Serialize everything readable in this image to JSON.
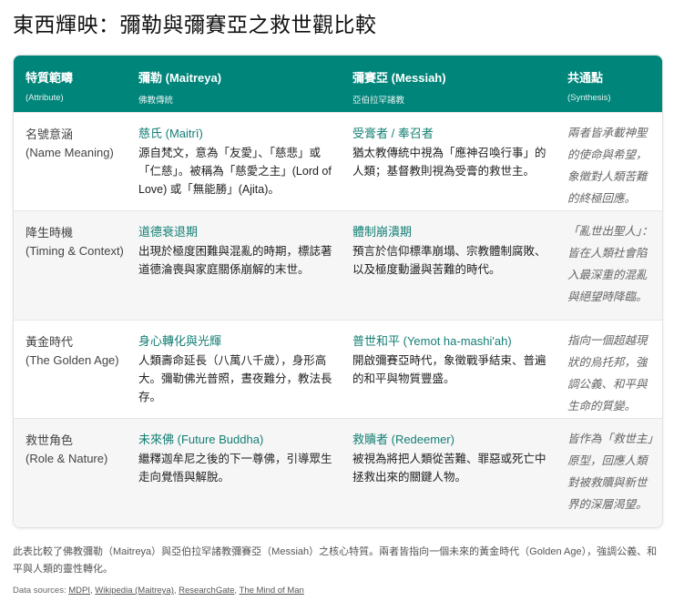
{
  "title": "東西輝映：彌勒與彌賽亞之救世觀比較",
  "header": [
    {
      "main": "特質範疇",
      "sub": "(Attribute)"
    },
    {
      "main": "彌勒 (Maitreya)",
      "sub": "佛教傳統"
    },
    {
      "main": "彌賽亞 (Messiah)",
      "sub": "亞伯拉罕諸教"
    },
    {
      "main": "共通點",
      "sub": "(Synthesis)"
    }
  ],
  "rows": [
    {
      "attr": "名號意涵",
      "attr_en": "(Name Meaning)",
      "m_term": "慈氏 (Maitrī)",
      "m_desc": "源自梵文，意為「友愛」、「慈悲」或「仁慈」。被稱為「慈愛之主」(Lord of Love) 或「無能勝」(Ajita)。",
      "s_term": "受膏者 / 奉召者",
      "s_desc": "猶太教傳統中視為「應神召喚行事」的人類；基督教則視為受膏的救世主。",
      "syn": "兩者皆承載神聖的使命與希望，象徵對人類苦難的終極回應。"
    },
    {
      "attr": "降生時機",
      "attr_en": "(Timing & Context)",
      "m_term": "道德衰退期",
      "m_desc": "出現於極度困難與混亂的時期，標誌著道德淪喪與家庭關係崩解的末世。",
      "s_term": "體制崩潰期",
      "s_desc": "預言於信仰標準崩塌、宗教體制腐敗、以及極度動盪與苦難的時代。",
      "syn": "「亂世出聖人」：皆在人類社會陷入最深重的混亂與絕望時降臨。"
    },
    {
      "attr": "黃金時代",
      "attr_en": "(The Golden Age)",
      "m_term": "身心轉化與光輝",
      "m_desc": "人類壽命延長（八萬八千歲），身形高大。彌勒佛光普照，晝夜難分，教法長存。",
      "s_term": "普世和平 (Yemot ha-mashi'ah)",
      "s_desc": "開啟彌賽亞時代，象徵戰爭結束、普遍的和平與物質豐盛。",
      "syn": "指向一個超越現狀的烏托邦，強調公義、和平與生命的質變。"
    },
    {
      "attr": "救世角色",
      "attr_en": "(Role & Nature)",
      "m_term": "未來佛 (Future Buddha)",
      "m_desc": "繼釋迦牟尼之後的下一尊佛，引導眾生走向覺悟與解脫。",
      "s_term": "救贖者 (Redeemer)",
      "s_desc": "被視為將把人類從苦難、罪惡或死亡中拯救出來的關鍵人物。",
      "syn": "皆作為「救世主」原型，回應人類對被救贖與新世界的深層渴望。"
    }
  ],
  "footer": "此表比較了佛教彌勒（Maitreya）與亞伯拉罕諸教彌賽亞（Messiah）之核心特質。兩者皆指向一個未來的黃金時代（Golden Age），強調公義、和平與人類的靈性轉化。",
  "sources": {
    "label": "Data sources:",
    "links": [
      "MDPI",
      "Wikipedia (Maitreya)",
      "ResearchGate",
      "The Mind of Man"
    ]
  },
  "colors": {
    "header": "#00857a",
    "term": "#137f74"
  }
}
